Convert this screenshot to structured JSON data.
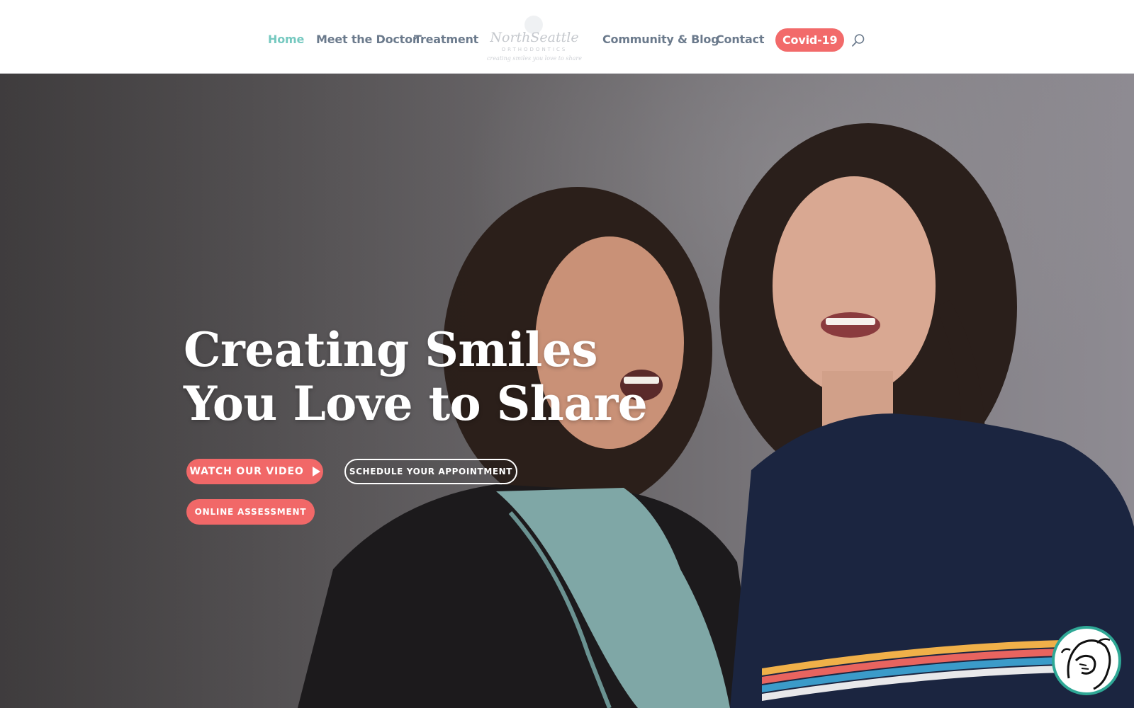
{
  "nav": {
    "items": [
      {
        "label": "Home",
        "active": true
      },
      {
        "label": "Meet the Doctor",
        "active": false
      },
      {
        "label": "Treatment",
        "active": false
      },
      {
        "label": "Community & Blog",
        "active": false
      },
      {
        "label": "Contact",
        "active": false
      }
    ],
    "covid_label": "Covid-19",
    "search_icon": "search-icon"
  },
  "logo": {
    "name": "NorthSeattle",
    "subtitle": "ORTHODONTICS",
    "tagline": "creating smiles you love to share"
  },
  "hero": {
    "headline_line1": "Creating Smiles",
    "headline_line2": "You Love to Share",
    "watch_video_label": "WATCH OUR VIDEO",
    "schedule_label": "SCHEDULE YOUR APPOINTMENT",
    "assessment_label": "ONLINE ASSESSMENT"
  },
  "colors": {
    "accent_coral": "#f26a6a",
    "active_teal": "#76c9c0",
    "nav_text": "#6b7a8c",
    "badge_ring": "#2fa896"
  }
}
